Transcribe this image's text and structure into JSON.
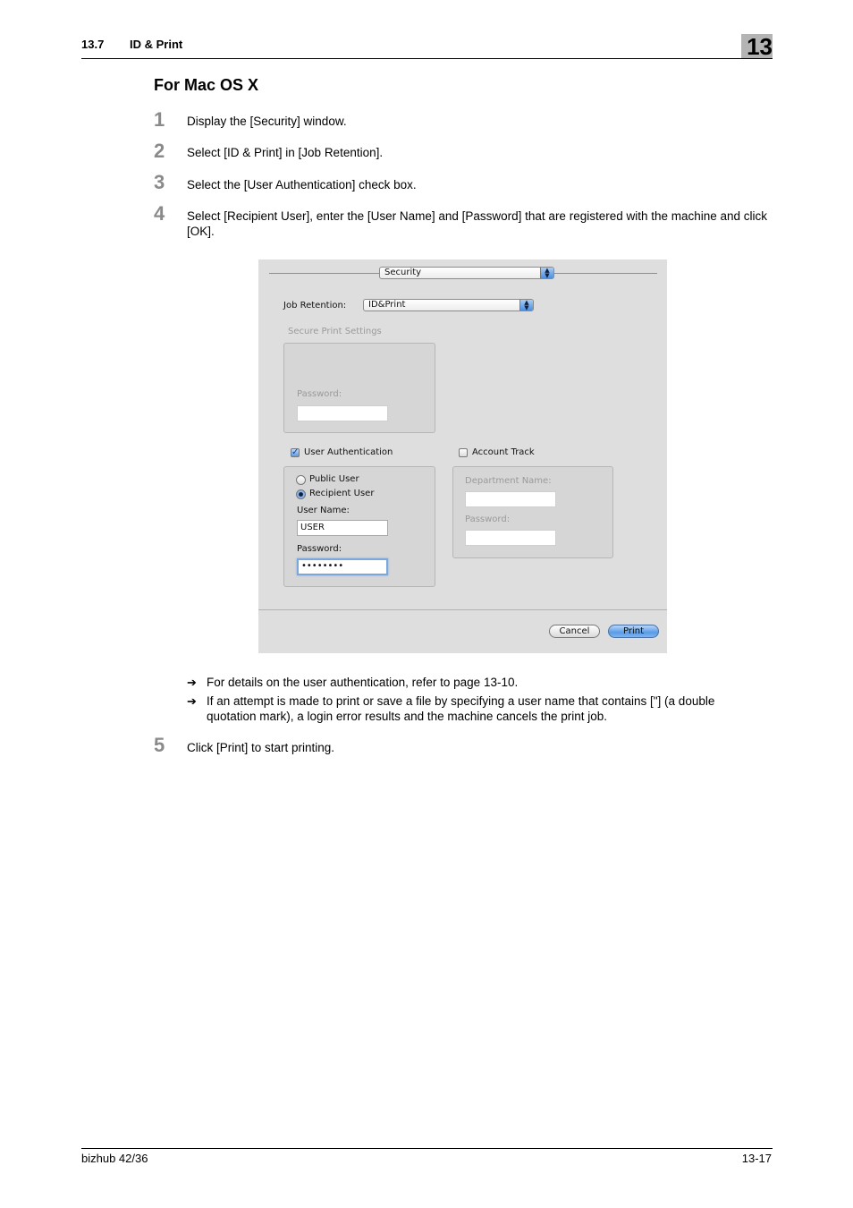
{
  "header": {
    "section_number": "13.7",
    "section_title": "ID & Print",
    "chapter_number": "13"
  },
  "section_heading": "For Mac OS X",
  "steps": [
    {
      "number": "1",
      "text": "Display the [Security] window."
    },
    {
      "number": "2",
      "text": "Select [ID & Print] in [Job Retention]."
    },
    {
      "number": "3",
      "text": "Select the [User Authentication] check box."
    },
    {
      "number": "4",
      "text": "Select [Recipient User], enter the [User Name] and [Password] that are registered with the machine and click [OK]."
    },
    {
      "number": "5",
      "text": "Click [Print] to start printing."
    }
  ],
  "notes": [
    {
      "arrow": "➔",
      "text": "For details on the user authentication, refer to page 13-10."
    },
    {
      "arrow": "➔",
      "text": "If an attempt is made to print or save a file by specifying a user name that contains [\"] (a double quotation mark), a login error results and the machine cancels the print job."
    }
  ],
  "dialog": {
    "panel_popup": {
      "value": "Security"
    },
    "job_retention": {
      "label": "Job Retention:",
      "value": "ID&Print"
    },
    "secure_print": {
      "group_label": "Secure Print Settings",
      "password_label": "Password:",
      "password_value": ""
    },
    "user_auth": {
      "label": "User Authentication",
      "checked": true,
      "public_user_label": "Public User",
      "recipient_user_label": "Recipient User",
      "selected": "Recipient User",
      "user_name_label": "User Name:",
      "user_name_value": "USER",
      "password_label": "Password:",
      "password_value": "••••••••"
    },
    "account_track": {
      "label": "Account Track",
      "checked": false,
      "department_label": "Department Name:",
      "department_value": "",
      "password_label": "Password:",
      "password_value": ""
    },
    "buttons": {
      "cancel": "Cancel",
      "print": "Print"
    },
    "icons": {
      "popup_stepper": "▲▼",
      "checkmark": "✓"
    }
  },
  "footer": {
    "model": "bizhub 42/36",
    "page": "13-17"
  }
}
